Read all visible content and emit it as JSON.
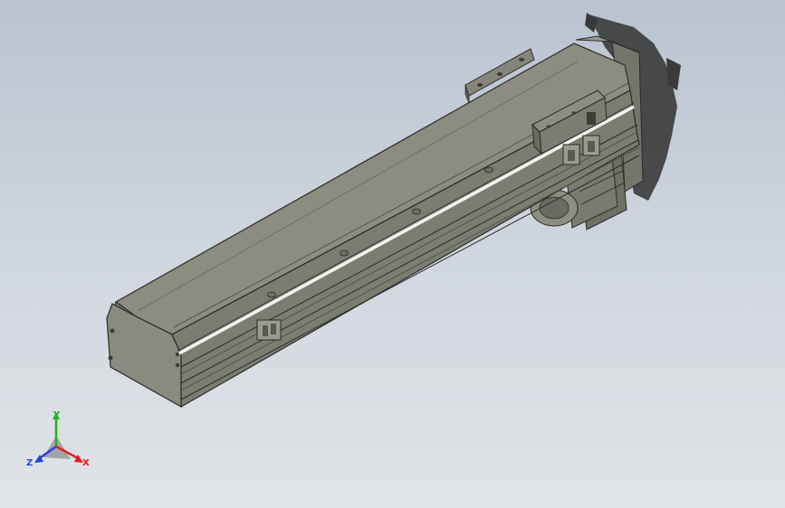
{
  "colors": {
    "background_top": "#b9c3cf",
    "background_bottom": "#e1e4e8",
    "body_top": "#8c8c81",
    "body_side": "#7c7c72",
    "body_dark": "#5e5e57",
    "edge": "#2c2c28",
    "rail_highlight": "#f4f4f2",
    "shadow": "#3a3a3a",
    "axis_x": "#e02020",
    "axis_y": "#22b022",
    "axis_z": "#2244dd"
  },
  "triad": {
    "x_label": "X",
    "y_label": "Y",
    "z_label": "Z"
  }
}
